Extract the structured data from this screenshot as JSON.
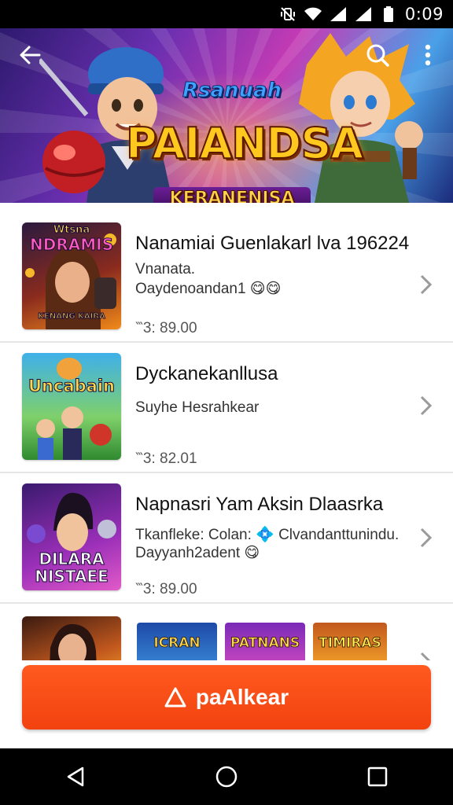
{
  "status_bar": {
    "time": "0:09",
    "icons": [
      "vibrate-off-icon",
      "wifi-icon",
      "signal-icon",
      "signal-icon",
      "battery-icon"
    ]
  },
  "banner": {
    "title_top": "Rsanuah",
    "title_main_line1": "PAIANDSA",
    "title_sub": "KERANENISA",
    "back_icon": "arrow-left-icon",
    "search_icon": "search-icon",
    "menu_icon": "more-vert-icon"
  },
  "items": [
    {
      "thumb_label": "NDRAMIS",
      "thumb_label_top": "Wtsna",
      "thumb_caption": "KENANG KAIRA",
      "title": "Nanamiai Guenlakarl lva 196224",
      "line1": "Vnanata.",
      "line2": "Oaydenoandan1 😋😋",
      "price": "‷3: 89.00"
    },
    {
      "thumb_label": "Uncabain",
      "title": "Dyckanekanllusa",
      "line1": "Suyhe Hesrahkear",
      "price": "‷3: 82.01"
    },
    {
      "thumb_label": "DILARA",
      "thumb_label2": "NISTAEE",
      "title": "Napnasri Yam Aksin Dlaasrka",
      "line1": "Tkanfleke: Colan: 💠 Clvandanttunindu.",
      "line2": "Dayyanh2adent 😋",
      "price": "‷3: 89.00"
    }
  ],
  "row4": {
    "minis": [
      "ICRAN",
      "PATNANS",
      "TIMIRAS"
    ]
  },
  "cta": {
    "label": "paAlkear",
    "icon": "triangle-icon"
  },
  "nav": {
    "back": "nav-back-icon",
    "home": "nav-home-icon",
    "recents": "nav-recents-icon"
  },
  "colors": {
    "accent": "#f2420f",
    "status_bar": "#000000",
    "divider": "#e6e6e6"
  }
}
